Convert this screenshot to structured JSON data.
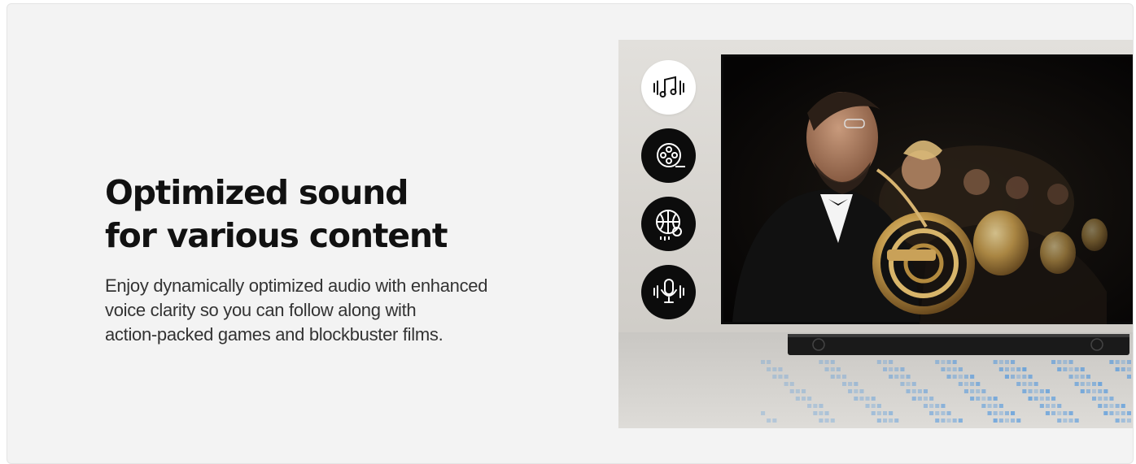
{
  "headline": {
    "line1": "Optimized sound",
    "line2": "for various content"
  },
  "body": {
    "line1": "Enjoy dynamically optimized audio with enhanced",
    "line2": "voice clarity so you can follow along with",
    "line3": "action-packed games and blockbuster films."
  },
  "mode_icons": [
    {
      "name": "music-icon",
      "state": "selected"
    },
    {
      "name": "film-reel-icon",
      "state": "default"
    },
    {
      "name": "basketball-icon",
      "state": "default"
    },
    {
      "name": "voice-microphone-icon",
      "state": "default"
    }
  ],
  "colors": {
    "background": "#f3f3f3",
    "headline": "#111111",
    "icon_dark": "#0c0c0c",
    "equalizer_blue": "#3d8ee0"
  }
}
